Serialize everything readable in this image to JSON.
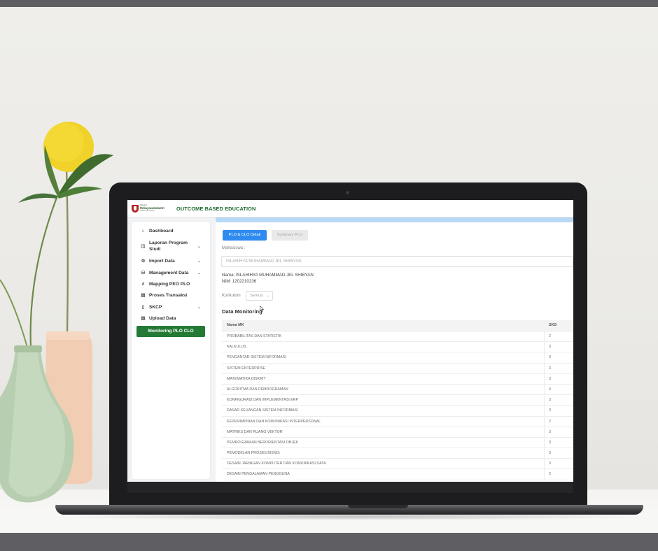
{
  "app": {
    "title": "OUTCOME BASED EDUCATION",
    "logo": {
      "line1": "Fakultas",
      "line2": "RekayasaIndustri",
      "line3": "Telkom University"
    }
  },
  "sidebar": {
    "items": [
      {
        "label": "Dashboard",
        "icon": "home-icon",
        "has_chevron": false
      },
      {
        "label": "Laporan Program Studi",
        "icon": "report-icon",
        "has_chevron": true
      },
      {
        "label": "Import Data",
        "icon": "import-icon",
        "has_chevron": true
      },
      {
        "label": "Management Data",
        "icon": "database-icon",
        "has_chevron": true
      },
      {
        "label": "Mapping PEO PLO",
        "icon": "link-icon",
        "has_chevron": false
      },
      {
        "label": "Proses Transaksi",
        "icon": "document-icon",
        "has_chevron": false
      },
      {
        "label": "SKCP",
        "icon": "file-icon",
        "has_chevron": true
      },
      {
        "label": "Upload Data",
        "icon": "upload-icon",
        "has_chevron": false
      },
      {
        "label": "Monitoring PLO CLO",
        "icon": "",
        "active": true
      }
    ]
  },
  "main": {
    "tabs": [
      {
        "label": "PLO & CLO Detail",
        "active": true
      },
      {
        "label": "Summary PLO",
        "active": false
      }
    ],
    "mahasiswa_label": "Mahasiswa :",
    "mahasiswa_value": "ISLAHIHYA MUHAMMAD JEL SHIBYAN",
    "nama": "Nama: ISLAHIHYA MUHAMMAD JEL SHIBYAN",
    "nim": "NIM: 1202210236",
    "kurikulum_label": "Kurikulum",
    "kurikulum_value": "Semua",
    "section_title": "Data Monitoring",
    "table": {
      "columns": [
        "Nama MK",
        "SKS"
      ],
      "rows": [
        [
          "PROBABILITAS DAN STATISTIK",
          "2"
        ],
        [
          "KALKULUS",
          "3"
        ],
        [
          "PENGANTAR SISTEM INFORMASI",
          "3"
        ],
        [
          "SISTEM ENTERPRISE",
          "3"
        ],
        [
          "MATEMATIKA DISKRIT",
          "3"
        ],
        [
          "ALGORITMA DAN PEMROGRAMAN",
          "4"
        ],
        [
          "KONFIGURASI DAN IMPLEMENTASI ERP",
          "3"
        ],
        [
          "DASAR KEUANGAN SISTEM INFORMASI",
          "3"
        ],
        [
          "KEPEMIMPINAN DAN KOMUNIKASI INTERPERSONAL",
          "2"
        ],
        [
          "MATRIKS DAN RUANG VEKTOR",
          "3"
        ],
        [
          "PEMROGRAMAN BERORIENTASI OBJEK",
          "3"
        ],
        [
          "PEMODELAN PROSES BISNIS",
          "3"
        ],
        [
          "DESAIN JARINGAN KOMPUTER DAN KOMUNIKASI DATA",
          "3"
        ],
        [
          "DESAIN PENGALAMAN PENGGUNA",
          "2"
        ]
      ]
    }
  },
  "colors": {
    "brand_green": "#1e6b2e",
    "active_nav": "#237a35",
    "primary_button": "#2f8bf0",
    "alert_strip": "#b7d9f7"
  }
}
